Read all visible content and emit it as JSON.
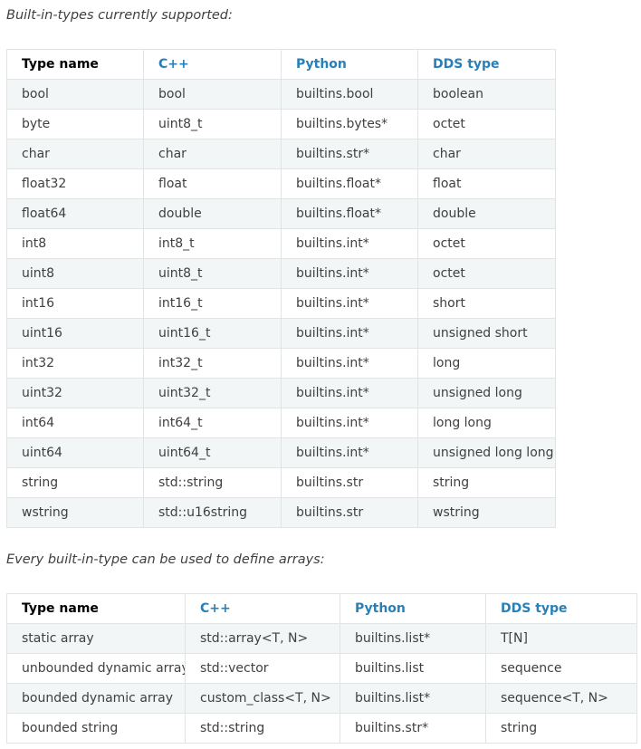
{
  "intro_builtin": "Built-in-types currently supported:",
  "intro_arrays": "Every built-in-type can be used to define arrays:",
  "builtin_table": {
    "headers": [
      "Type name",
      "C++",
      "Python",
      "DDS type"
    ],
    "rows": [
      [
        "bool",
        "bool",
        "builtins.bool",
        "boolean"
      ],
      [
        "byte",
        "uint8_t",
        "builtins.bytes*",
        "octet"
      ],
      [
        "char",
        "char",
        "builtins.str*",
        "char"
      ],
      [
        "float32",
        "float",
        "builtins.float*",
        "float"
      ],
      [
        "float64",
        "double",
        "builtins.float*",
        "double"
      ],
      [
        "int8",
        "int8_t",
        "builtins.int*",
        "octet"
      ],
      [
        "uint8",
        "uint8_t",
        "builtins.int*",
        "octet"
      ],
      [
        "int16",
        "int16_t",
        "builtins.int*",
        "short"
      ],
      [
        "uint16",
        "uint16_t",
        "builtins.int*",
        "unsigned short"
      ],
      [
        "int32",
        "int32_t",
        "builtins.int*",
        "long"
      ],
      [
        "uint32",
        "uint32_t",
        "builtins.int*",
        "unsigned long"
      ],
      [
        "int64",
        "int64_t",
        "builtins.int*",
        "long long"
      ],
      [
        "uint64",
        "uint64_t",
        "builtins.int*",
        "unsigned long long"
      ],
      [
        "string",
        "std::string",
        "builtins.str",
        "string"
      ],
      [
        "wstring",
        "std::u16string",
        "builtins.str",
        "wstring"
      ]
    ]
  },
  "array_table": {
    "headers": [
      "Type name",
      "C++",
      "Python",
      "DDS type"
    ],
    "rows": [
      [
        "static array",
        "std::array<T, N>",
        "builtins.list*",
        "T[N]"
      ],
      [
        "unbounded dynamic array",
        "std::vector",
        "builtins.list",
        "sequence"
      ],
      [
        "bounded dynamic array",
        "custom_class<T, N>",
        "builtins.list*",
        "sequence<T, N>"
      ],
      [
        "bounded string",
        "std::string",
        "builtins.str*",
        "string"
      ]
    ]
  },
  "colors": {
    "header_link": "#2980b9",
    "text": "#404040",
    "row_stripe": "#f3f6f6",
    "border": "#e1e4e5"
  }
}
